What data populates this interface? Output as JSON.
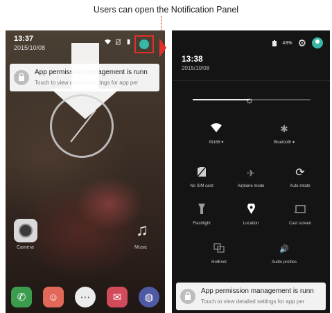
{
  "caption": "Users can open the Notification Panel",
  "left_screen": {
    "time": "13:37",
    "date": "2015/10/08",
    "notification": {
      "title": "App permission management is runn",
      "subtitle": "Touch to view detailed settings for app per"
    },
    "apps": {
      "camera_label": "Camera",
      "music_label": "Music"
    },
    "dock": [
      "phone-icon",
      "contacts-icon",
      "apps-icon",
      "messages-icon",
      "browser-icon"
    ]
  },
  "right_screen": {
    "battery": "43%",
    "time": "13:38",
    "date": "2015/10/08",
    "brightness_level": 0.48,
    "tiles": [
      {
        "label": "IN168 ▾",
        "icon": "wifi-icon"
      },
      {
        "label": "Bluetooth ▾",
        "icon": "bluetooth-icon"
      },
      {
        "label": "No SIM card",
        "icon": "no-sim-icon"
      },
      {
        "label": "Airplane mode",
        "icon": "airplane-icon"
      },
      {
        "label": "Auto-rotate",
        "icon": "auto-rotate-icon"
      },
      {
        "label": "Flashlight",
        "icon": "flashlight-icon"
      },
      {
        "label": "Location",
        "icon": "location-icon"
      },
      {
        "label": "Cast screen",
        "icon": "cast-icon"
      },
      {
        "label": "HotKnot",
        "icon": "hotknot-icon"
      },
      {
        "label": "Audio profiles",
        "icon": "audio-profile-icon"
      }
    ],
    "notification": {
      "title": "App permission management is runn",
      "subtitle": "Touch to view detailed settings for app per"
    }
  },
  "colors": {
    "highlight": "#e0302a",
    "avatar": "#39b7a7"
  }
}
